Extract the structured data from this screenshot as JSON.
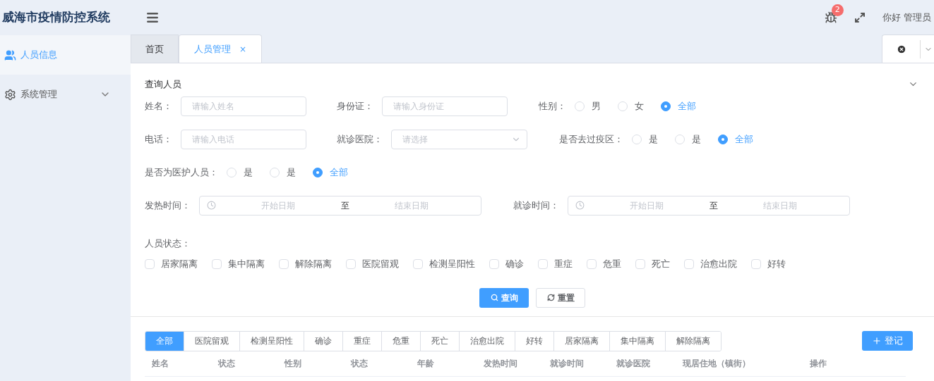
{
  "header": {
    "title": "威海市疫情防控系统",
    "notification_count": "2",
    "greeting": "你好 管理员"
  },
  "sidebar": {
    "items": [
      {
        "label": "人员信息",
        "selected": true,
        "kind": "users"
      },
      {
        "label": "系统管理",
        "selected": false,
        "kind": "settings"
      }
    ]
  },
  "tabs": [
    {
      "label": "首页",
      "selected": false
    },
    {
      "label": "人员管理",
      "selected": true,
      "close": "×"
    }
  ],
  "query": {
    "title": "查询人员",
    "rows": [
      {
        "fields": [
          {
            "kind": "input",
            "label": "姓名：",
            "placeholder": "请输入姓名"
          },
          {
            "kind": "input",
            "label": "身份证：",
            "placeholder": "请输入身份证"
          },
          {
            "kind": "radio",
            "label": "性别：",
            "options": [
              {
                "label": "男",
                "selected": false
              },
              {
                "label": "女",
                "selected": false
              },
              {
                "label": "全部",
                "selected": true
              }
            ]
          }
        ]
      },
      {
        "fields": [
          {
            "kind": "input",
            "label": "电话：",
            "placeholder": "请输入电话"
          },
          {
            "kind": "select",
            "label": "就诊医院：",
            "placeholder": "请选择"
          },
          {
            "kind": "radio",
            "label": "是否去过疫区：",
            "options": [
              {
                "label": "是",
                "selected": false
              },
              {
                "label": "是",
                "selected": false
              },
              {
                "label": "全部",
                "selected": true
              }
            ]
          }
        ]
      },
      {
        "fields": [
          {
            "kind": "radio",
            "label": "是否为医护人员：",
            "options": [
              {
                "label": "是",
                "selected": false
              },
              {
                "label": "是",
                "selected": false
              },
              {
                "label": "全部",
                "selected": true
              }
            ]
          }
        ]
      },
      {
        "fields": [
          {
            "kind": "daterange",
            "label": "发热时间：",
            "start_placeholder": "开始日期",
            "separator": "至",
            "end_placeholder": "结束日期"
          },
          {
            "kind": "daterange",
            "label": "就诊时间：",
            "start_placeholder": "开始日期",
            "separator": "至",
            "end_placeholder": "结束日期"
          }
        ]
      }
    ],
    "status_label": "人员状态：",
    "statuses": [
      {
        "label": "居家隔离",
        "checked": false
      },
      {
        "label": "集中隔离",
        "checked": false
      },
      {
        "label": "解除隔离",
        "checked": false
      },
      {
        "label": "医院留观",
        "checked": false
      },
      {
        "label": "检测呈阳性",
        "checked": false
      },
      {
        "label": "确诊",
        "checked": false
      },
      {
        "label": "重症",
        "checked": false
      },
      {
        "label": "危重",
        "checked": false
      },
      {
        "label": "死亡",
        "checked": false
      },
      {
        "label": "治愈出院",
        "checked": false
      },
      {
        "label": "好转",
        "checked": false
      }
    ],
    "buttons": [
      {
        "label": "查询",
        "kind": "primary"
      },
      {
        "label": "重置",
        "kind": "default"
      }
    ]
  },
  "filters": [
    {
      "label": "全部",
      "selected": true
    },
    {
      "label": "医院留观",
      "selected": false
    },
    {
      "label": "检测呈阳性",
      "selected": false
    },
    {
      "label": "确诊",
      "selected": false
    },
    {
      "label": "重症",
      "selected": false
    },
    {
      "label": "危重",
      "selected": false
    },
    {
      "label": "死亡",
      "selected": false
    },
    {
      "label": "治愈出院",
      "selected": false
    },
    {
      "label": "好转",
      "selected": false
    },
    {
      "label": "居家隔离",
      "selected": false
    },
    {
      "label": "集中隔离",
      "selected": false
    },
    {
      "label": "解除隔离",
      "selected": false
    }
  ],
  "register_button": "登记",
  "table": {
    "columns": [
      "姓名",
      "状态",
      "性别",
      "状态",
      "年龄",
      "发热时间",
      "就诊时间",
      "就诊医院",
      "现居住地（镇街）",
      "操作"
    ]
  }
}
